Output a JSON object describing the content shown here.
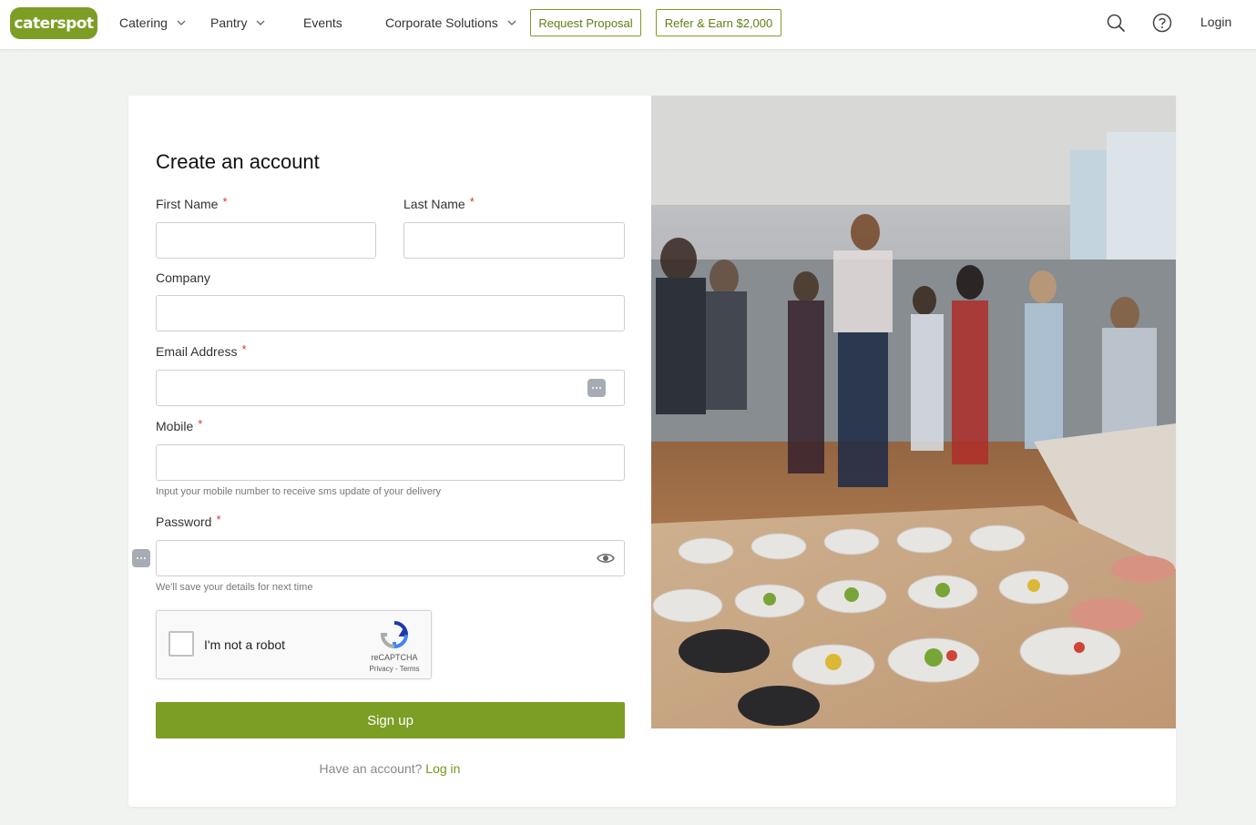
{
  "brand": {
    "logo_text": "caterspot",
    "accent": "#7c9e25"
  },
  "nav": {
    "catering": "Catering",
    "pantry": "Pantry",
    "events": "Events",
    "corporate": "Corporate Solutions",
    "request_proposal": "Request Proposal",
    "refer_earn": "Refer & Earn $2,000",
    "login": "Login"
  },
  "form": {
    "title": "Create an account",
    "first_name": {
      "label": "First Name",
      "required": "*",
      "value": ""
    },
    "last_name": {
      "label": "Last Name",
      "required": "*",
      "value": ""
    },
    "company": {
      "label": "Company",
      "value": ""
    },
    "email": {
      "label": "Email Address",
      "required": "*",
      "value": ""
    },
    "mobile": {
      "label": "Mobile",
      "required": "*",
      "value": "",
      "helper": "Input your mobile number to receive sms update of your delivery"
    },
    "password": {
      "label": "Password",
      "required": "*",
      "value": "",
      "helper": "We'll save your details for next time"
    },
    "captcha": {
      "text": "I'm not a robot",
      "brand": "reCAPTCHA",
      "links": "Privacy - Terms"
    },
    "submit": "Sign up",
    "have_account": "Have an account?",
    "login_link": "Log in"
  },
  "icons": [
    "search-icon",
    "help-icon",
    "chevron-down-icon",
    "eye-icon",
    "password-manager-icon",
    "recaptcha-icon"
  ]
}
